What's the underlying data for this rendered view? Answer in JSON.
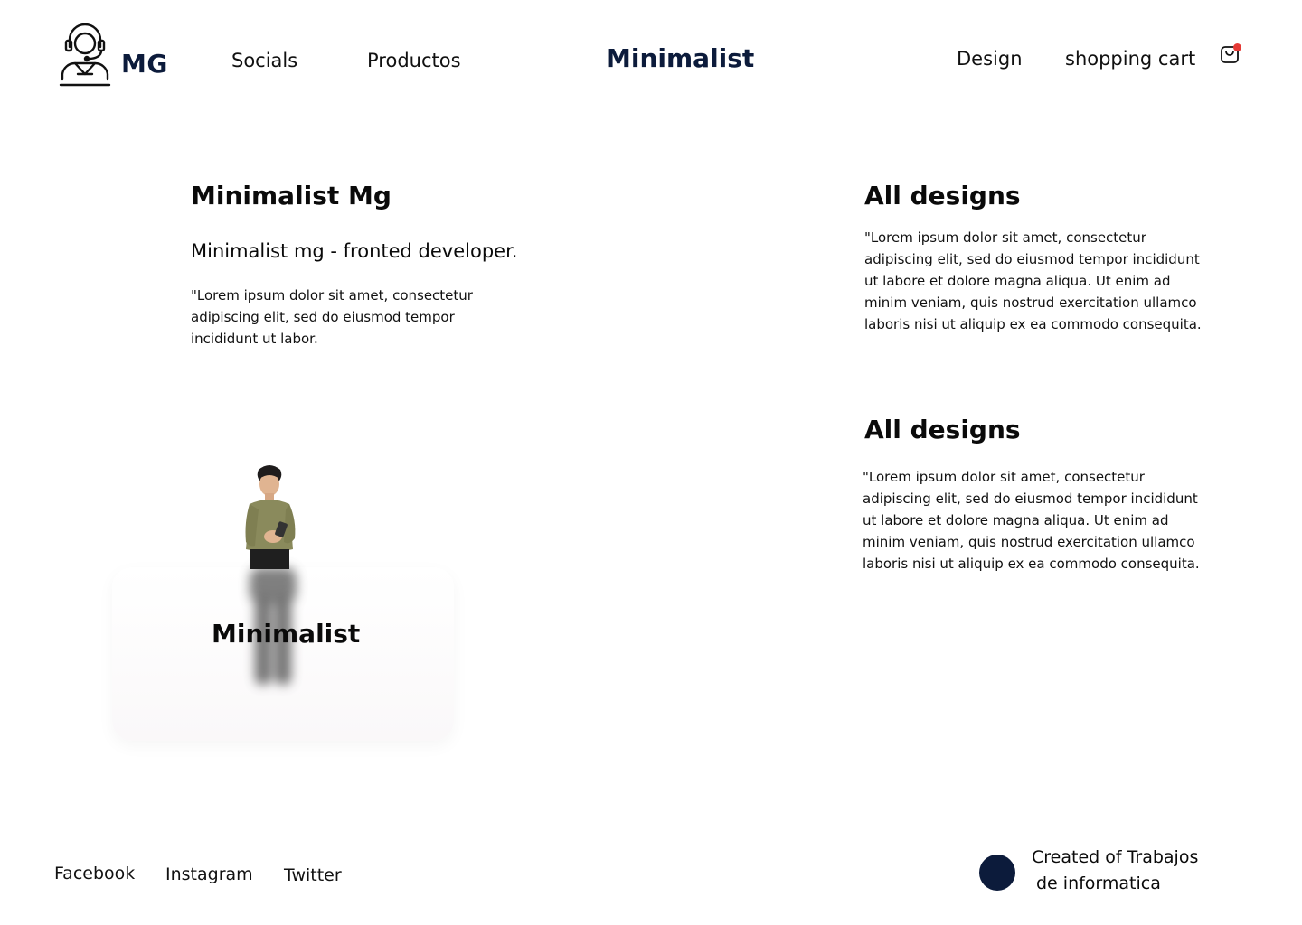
{
  "colors": {
    "brand_navy": "#0c1b3b",
    "cart_badge": "#e53935",
    "character_shirt": "#8a8a5c"
  },
  "header": {
    "logo_icon": "support-agent-icon",
    "logo_text": "MG",
    "nav": [
      "Socials",
      "Productos"
    ],
    "brand": "Minimalist",
    "nav_right": [
      "Design",
      "shopping cart"
    ],
    "cart_icon": "shopping-bag-icon"
  },
  "intro": {
    "title": "Minimalist Mg",
    "subtitle": "Minimalist mg - fronted developer.",
    "body": "\"Lorem ipsum dolor sit amet, consectetur adipiscing elit, sed do eiusmod tempor incididunt ut labor."
  },
  "designs": [
    {
      "title": "All designs",
      "body": "\"Lorem ipsum dolor sit amet, consectetur adipiscing elit, sed do eiusmod tempor incididunt ut labore et dolore magna aliqua. Ut enim ad minim veniam, quis nostrud exercitation ullamco laboris nisi ut aliquip ex ea commodo consequita."
    },
    {
      "title": "All designs",
      "body": "\"Lorem ipsum dolor sit amet, consectetur adipiscing elit, sed do eiusmod tempor incididunt ut labore et dolore magna aliqua. Ut enim ad minim veniam, quis nostrud exercitation ullamco laboris nisi ut aliquip ex ea commodo consequita."
    }
  ],
  "card": {
    "label": "Minimalist",
    "image": "3d-character-with-phone"
  },
  "footer": {
    "links": [
      "Facebook",
      "Instagram",
      "Twitter"
    ],
    "credit_line1": "Created of Trabajos",
    "credit_line2": "de informatica"
  }
}
